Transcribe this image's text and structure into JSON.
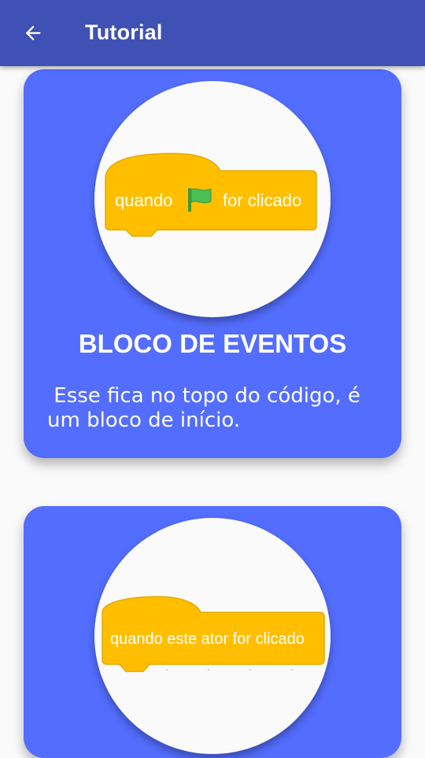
{
  "appbar": {
    "title": "Tutorial",
    "back_icon": "arrow-back-icon",
    "color": "#3f51b5"
  },
  "cards": [
    {
      "block_text_before": "quando",
      "block_text_after": "for clicado",
      "block_icon": "green-flag-icon",
      "heading": "BLOCO DE EVENTOS",
      "description": " Esse fica no topo do código, é um bloco de início."
    },
    {
      "block_text": "quando este ator for clicado"
    }
  ],
  "colors": {
    "card": "#536dfe",
    "block": "#ffbf00",
    "flag": "#4cbf56"
  }
}
